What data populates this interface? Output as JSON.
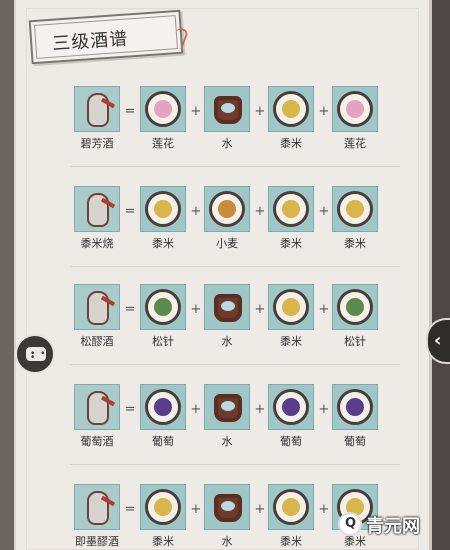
{
  "header": {
    "title": "三级酒谱"
  },
  "recipes": [
    {
      "result": "碧芳酒",
      "ingredients": [
        "莲花",
        "水",
        "黍米",
        "莲花"
      ]
    },
    {
      "result": "黍米烧",
      "ingredients": [
        "黍米",
        "小麦",
        "黍米",
        "黍米"
      ]
    },
    {
      "result": "松醪酒",
      "ingredients": [
        "松针",
        "水",
        "黍米",
        "松针"
      ]
    },
    {
      "result": "葡萄酒",
      "ingredients": [
        "葡萄",
        "水",
        "葡萄",
        "葡萄"
      ]
    },
    {
      "result": "即墨醪酒",
      "ingredients": [
        "黍米",
        "水",
        "黍米",
        "黍米"
      ]
    }
  ],
  "operators": {
    "equals": "=",
    "plus": "+"
  },
  "icons": {
    "chat": "chat-bubble-icon",
    "nav": "chevron-left-icon"
  },
  "watermark": {
    "logo_char": "Q",
    "text": "青元网"
  },
  "colors": {
    "tile": "#9fc7c8",
    "paper": "#eeeae6",
    "millet": "#d8b64a",
    "lotus": "#e4a2c1",
    "grape": "#5a3d8a",
    "pine": "#5b8a4a",
    "wheat": "#c98a3a"
  }
}
